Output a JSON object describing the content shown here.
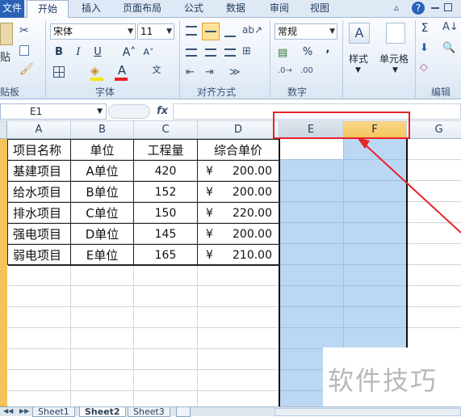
{
  "ribbon": {
    "tabs": [
      {
        "label": "文件"
      },
      {
        "label": "开始"
      },
      {
        "label": "插入"
      },
      {
        "label": "页面布局"
      },
      {
        "label": "公式"
      },
      {
        "label": "数据"
      },
      {
        "label": "审阅"
      },
      {
        "label": "视图"
      }
    ],
    "font_name": "宋体",
    "font_size": "11",
    "number_format": "常规",
    "groups": {
      "clipboard": "贴板",
      "font": "字体",
      "alignment": "对齐方式",
      "number": "数字",
      "editing": "编辑"
    },
    "styles_label": "样式",
    "cells_label": "单元格",
    "paste_label": "贴",
    "bold": "B",
    "italic": "I",
    "underline": "U",
    "font_color_glyph": "A",
    "percent": "%",
    "comma": ",",
    "sigma": "Σ",
    "wen": "文"
  },
  "formula_bar": {
    "name_box": "E1",
    "fx": "fx"
  },
  "grid": {
    "columns": [
      "A",
      "B",
      "C",
      "D",
      "E",
      "F",
      "G"
    ],
    "header": [
      "项目名称",
      "单位",
      "工程量",
      "综合单价"
    ],
    "rows": [
      [
        "基建项目",
        "A单位",
        "420",
        "¥",
        "200.00"
      ],
      [
        "给水项目",
        "B单位",
        "152",
        "¥",
        "200.00"
      ],
      [
        "排水项目",
        "C单位",
        "150",
        "¥",
        "220.00"
      ],
      [
        "强电项目",
        "D单位",
        "145",
        "¥",
        "200.00"
      ],
      [
        "弱电项目",
        "E单位",
        "165",
        "¥",
        "210.00"
      ]
    ]
  },
  "sheets": [
    "Sheet1",
    "Sheet2",
    "Sheet3"
  ],
  "watermark": "软件技巧",
  "colors": {
    "selection": "#bcd7f3",
    "annotation": "#e8222a",
    "active_header": "#f4c35a"
  }
}
